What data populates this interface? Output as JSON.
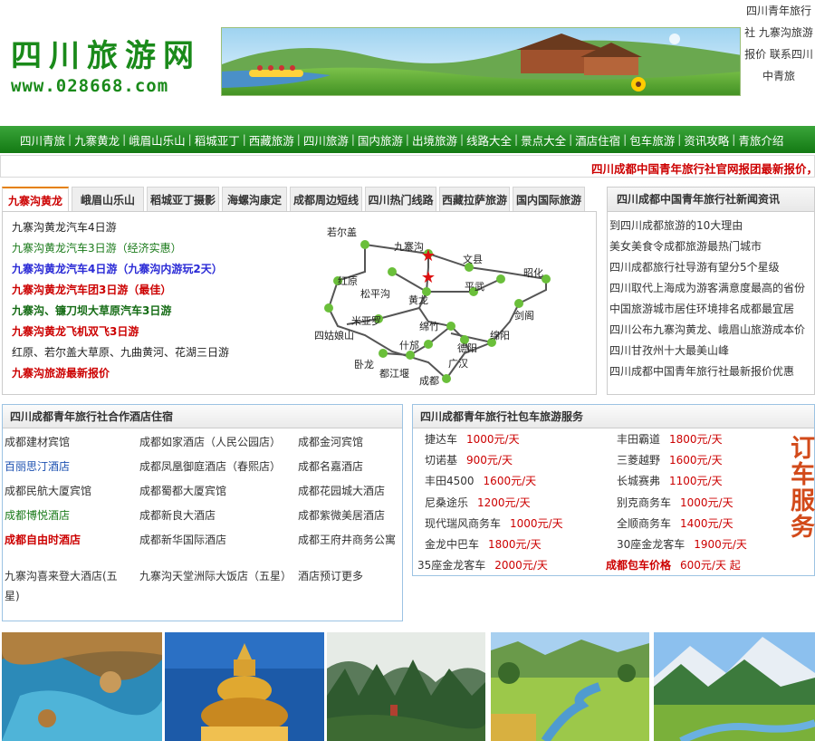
{
  "header": {
    "logo_title": "四川旅游网",
    "logo_url": "www.028668.com",
    "top_links": [
      "四川青年旅行社",
      "九寨沟旅游报价",
      "联系四川中青旅"
    ]
  },
  "nav": [
    "四川青旅",
    "九寨黄龙",
    "峨眉山乐山",
    "稻城亚丁",
    "西藏旅游",
    "四川旅游",
    "国内旅游",
    "出境旅游",
    "线路大全",
    "景点大全",
    "酒店住宿",
    "包车旅游",
    "资讯攻略",
    "青旅介绍"
  ],
  "marquee": "四川成都中国青年旅行社官网报团最新报价，",
  "tabs": [
    "九寨沟黄龙",
    "峨眉山乐山",
    "稻城亚丁摄影",
    "海螺沟康定",
    "成都周边短线",
    "四川热门线路",
    "西藏拉萨旅游",
    "国内国际旅游"
  ],
  "routes": [
    "九寨沟黄龙汽车4日游",
    "九寨沟黄龙汽车3日游（经济实惠）",
    "九寨沟黄龙汽车4日游（九寨沟内游玩2天）",
    "九寨沟黄龙汽车团3日游（最佳）",
    "九寨沟、镰刀坝大草原汽车3日游",
    "九寨沟黄龙飞机双飞3日游",
    "红原、若尔盖大草原、九曲黄河、花湖三日游",
    "九寨沟旅游最新报价"
  ],
  "map_labels": [
    "若尔盖",
    "九寨沟",
    "文县",
    "昭化",
    "红原",
    "松平沟",
    "黄龙",
    "平武",
    "剑阁",
    "米亚罗",
    "绵竹",
    "绵阳",
    "四姑娘山",
    "什邡",
    "德阳",
    "卧龙",
    "都江堰",
    "广汉",
    "成都"
  ],
  "news": {
    "title": "四川成都中国青年旅行社新闻资讯",
    "items": [
      "到四川成都旅游的10大理由",
      "美女美食令成都旅游最热门城市",
      "四川成都旅行社导游有望分5个星级",
      "四川取代上海成为游客满意度最高的省份",
      "中国旅游城市居住环境排名成都最宜居",
      "四川公布九寨沟黄龙、峨眉山旅游成本价",
      "四川甘孜州十大最美山峰",
      "四川成都中国青年旅行社最新报价优惠"
    ]
  },
  "hotels": {
    "title": "四川成都青年旅行社合作酒店住宿",
    "cells": [
      "成都建材宾馆",
      "成都如家酒店（人民公园店）",
      "成都金河宾馆",
      "百丽思汀酒店",
      "成都凤凰御庭酒店（春熙店）",
      "成都名嘉酒店",
      "成都民航大厦宾馆",
      "成都蜀都大厦宾馆",
      "成都花园城大酒店",
      "成都博悦酒店",
      "成都新良大酒店",
      "成都紫微美居酒店",
      "成都自由时酒店",
      "成都新华国际酒店",
      "成都王府井商务公寓",
      "九寨沟喜来登大酒店(五星)",
      "九寨沟天堂洲际大饭店（五星）",
      "酒店预订更多"
    ]
  },
  "cars": {
    "title": "四川成都青年旅行社包车旅游服务",
    "items": [
      {
        "name": "捷达车",
        "price": "1000元/天"
      },
      {
        "name": "丰田霸道",
        "price": "1800元/天"
      },
      {
        "name": "切诺基",
        "price": "900元/天"
      },
      {
        "name": "三菱越野",
        "price": "1600元/天"
      },
      {
        "name": "丰田4500",
        "price": "1600元/天"
      },
      {
        "name": "长城赛弗",
        "price": "1100元/天"
      },
      {
        "name": "尼桑途乐",
        "price": "1200元/天"
      },
      {
        "name": "别克商务车",
        "price": "1000元/天"
      },
      {
        "name": "现代瑞风商务车",
        "price": "1000元/天"
      },
      {
        "name": "全顺商务车",
        "price": "1400元/天"
      },
      {
        "name": "金龙中巴车",
        "price": "1800元/天"
      },
      {
        "name": "30座金龙客车",
        "price": "1900元/天"
      },
      {
        "name": "35座金龙客车",
        "price": "2000元/天"
      },
      {
        "name": "成都包车价格",
        "price": "600元/天 起"
      }
    ],
    "vertical_label": "订车服务"
  },
  "colors": {
    "brand_green": "#1a8a1a",
    "nav_green": "#137913",
    "accent_red": "#cc0000"
  }
}
